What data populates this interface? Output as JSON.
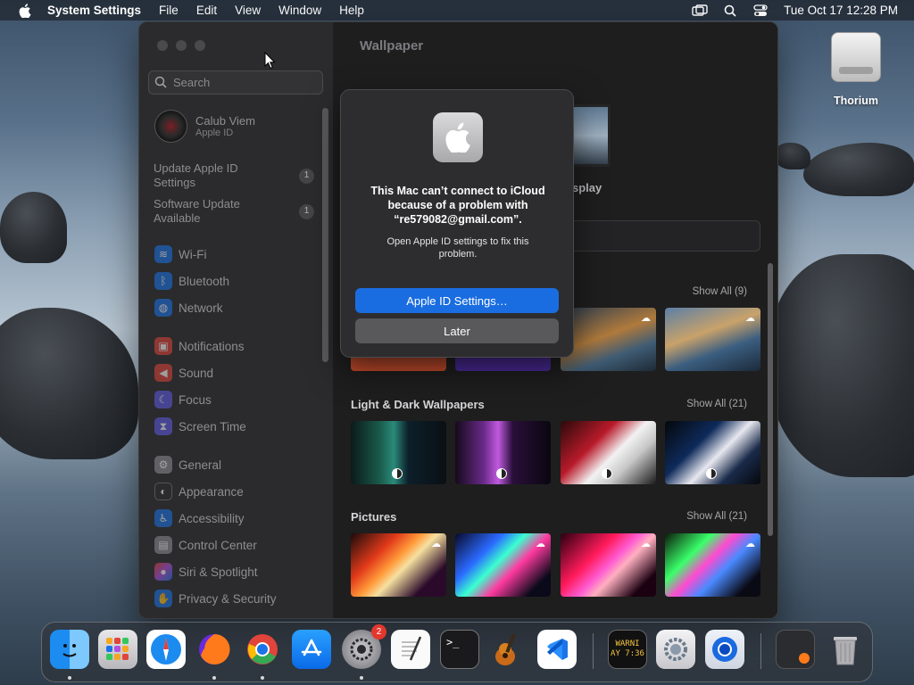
{
  "menubar": {
    "app_name": "System Settings",
    "menus": [
      "File",
      "Edit",
      "View",
      "Window",
      "Help"
    ],
    "clock": "Tue Oct 17  12:28 PM"
  },
  "desktop": {
    "drive_label": "Thorium"
  },
  "sidebar": {
    "search_placeholder": "Search",
    "user_name": "Calub Viem",
    "user_sub": "Apple ID",
    "notices": [
      {
        "label": "Update Apple ID Settings",
        "badge": "1"
      },
      {
        "label": "Software Update Available",
        "badge": "1"
      }
    ],
    "items": [
      {
        "label": "Wi-Fi",
        "icon": "wifi-icon",
        "color": "#1a73e8"
      },
      {
        "label": "Bluetooth",
        "icon": "bluetooth-icon",
        "color": "#1a73e8"
      },
      {
        "label": "Network",
        "icon": "globe-icon",
        "color": "#1a73e8"
      },
      {
        "label": "Notifications",
        "icon": "bell-icon",
        "color": "#e0443b"
      },
      {
        "label": "Sound",
        "icon": "speaker-icon",
        "color": "#e0443b"
      },
      {
        "label": "Focus",
        "icon": "moon-icon",
        "color": "#5e5ce6"
      },
      {
        "label": "Screen Time",
        "icon": "hourglass-icon",
        "color": "#5e5ce6"
      },
      {
        "label": "General",
        "icon": "gear-icon",
        "color": "#8e8e93"
      },
      {
        "label": "Appearance",
        "icon": "appearance-icon",
        "color": "#2c2c2e"
      },
      {
        "label": "Accessibility",
        "icon": "accessibility-icon",
        "color": "#1a73e8"
      },
      {
        "label": "Control Center",
        "icon": "control-center-icon",
        "color": "#8e8e93"
      },
      {
        "label": "Siri & Spotlight",
        "icon": "siri-icon",
        "color": "#b250e0"
      },
      {
        "label": "Privacy & Security",
        "icon": "hand-icon",
        "color": "#1a73e8"
      }
    ]
  },
  "content": {
    "title": "Wallpaper",
    "display_label": "splay",
    "sections": [
      {
        "title": "",
        "show_all": "Show All (9)"
      },
      {
        "title": "Light & Dark Wallpapers",
        "show_all": "Show All (21)"
      },
      {
        "title": "Pictures",
        "show_all": "Show All (21)"
      }
    ]
  },
  "dialog": {
    "message": "This Mac can’t connect to iCloud because of a problem with “re579082@gmail.com”.",
    "info": "Open Apple ID settings to fix this problem.",
    "primary_button": "Apple ID Settings…",
    "secondary_button": "Later"
  },
  "dock": {
    "system_settings_badge": "2",
    "console_text": "WARNI\nAY 7:36"
  }
}
